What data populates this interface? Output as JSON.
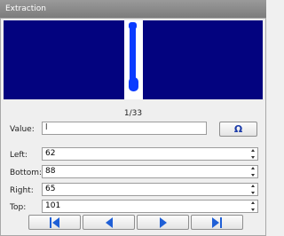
{
  "window": {
    "title": "Extraction"
  },
  "preview": {
    "background": "#03037f",
    "glyph_color": "#0a3bff",
    "cell_color": "#ffffff"
  },
  "status": {
    "counter": "1/33"
  },
  "value": {
    "label": "Value:",
    "text": "l",
    "omega_button": "Ω"
  },
  "bounds": {
    "left": {
      "label": "Left:",
      "value": "62"
    },
    "bottom": {
      "label": "Bottom:",
      "value": "88"
    },
    "right": {
      "label": "Right:",
      "value": "65"
    },
    "top": {
      "label": "Top:",
      "value": "101"
    }
  },
  "navigation": {
    "icons": [
      "first-icon",
      "previous-icon",
      "next-icon",
      "last-icon"
    ],
    "accent": "#1f5fd6"
  }
}
